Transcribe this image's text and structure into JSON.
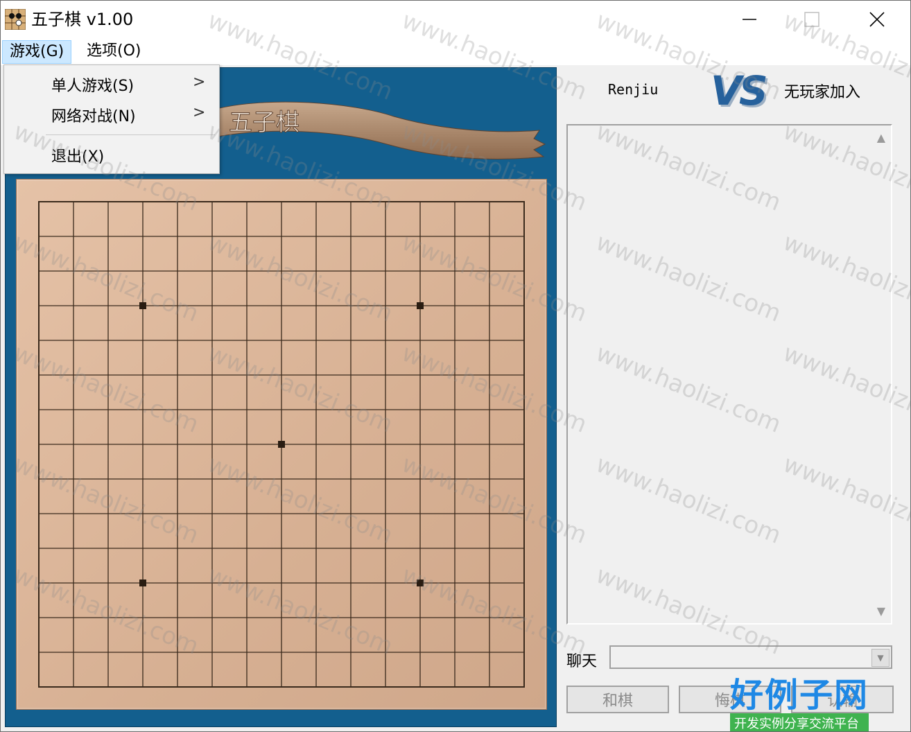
{
  "window": {
    "title": "五子棋 v1.00"
  },
  "menubar": {
    "game": "游戏(G)",
    "options": "选项(O)"
  },
  "game_menu": {
    "single": "单人游戏(S)",
    "network": "网络对战(N)",
    "exit": "退出(X)",
    "arrow": ">"
  },
  "banner": {
    "text": "五子棋"
  },
  "players": {
    "left": "Renjiu",
    "vs": "VS",
    "right": "无玩家加入"
  },
  "chat": {
    "label": "聊天",
    "value": ""
  },
  "buttons": {
    "draw": "和棋",
    "undo": "悔棋",
    "resign": "认输"
  },
  "watermark": {
    "text": "www.haolizi.com"
  },
  "logo": {
    "main": "好例子网",
    "sub": "开发实例分享交流平台"
  },
  "board": {
    "lines": 15,
    "star_points": [
      [
        3,
        3
      ],
      [
        11,
        3
      ],
      [
        7,
        7
      ],
      [
        3,
        11
      ],
      [
        11,
        11
      ]
    ]
  },
  "colors": {
    "board_bg": "#135f8e",
    "wood": "#dcb597",
    "menu_highlight": "#cce8ff"
  }
}
